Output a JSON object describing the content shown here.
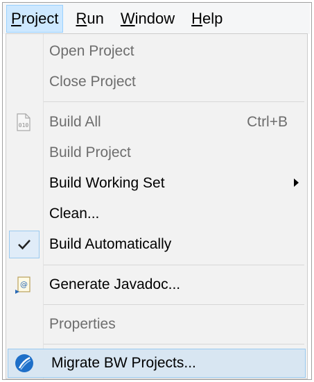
{
  "menubar": {
    "items": [
      {
        "label": "Project",
        "mnemonic": "P",
        "rest": "roject",
        "pre": ""
      },
      {
        "label": "Run",
        "mnemonic": "R",
        "rest": "un",
        "pre": ""
      },
      {
        "label": "Window",
        "mnemonic": "W",
        "rest": "indow",
        "pre": ""
      },
      {
        "label": "Help",
        "mnemonic": "H",
        "rest": "elp",
        "pre": ""
      }
    ]
  },
  "dropdown": {
    "open_project": "Open Project",
    "close_project": "Close Project",
    "build_all": "Build All",
    "build_all_shortcut": "Ctrl+B",
    "build_all_icon_text": "010",
    "build_project": "Build Project",
    "build_working_set": "Build Working Set",
    "clean": "Clean...",
    "build_automatically": "Build Automatically",
    "generate_javadoc": "Generate Javadoc...",
    "properties": "Properties",
    "migrate_bw": "Migrate BW Projects..."
  },
  "icons": {
    "build_all": "binary-file-icon",
    "build_automatically": "checkmark-icon",
    "generate_javadoc": "javadoc-icon",
    "migrate_bw": "tibco-bw-icon"
  },
  "colors": {
    "menu_active_bg": "#cde8ff",
    "hover_bg": "#d8e6f2",
    "disabled_text": "#6d6d6d",
    "accent_blue": "#1e6fc8"
  }
}
